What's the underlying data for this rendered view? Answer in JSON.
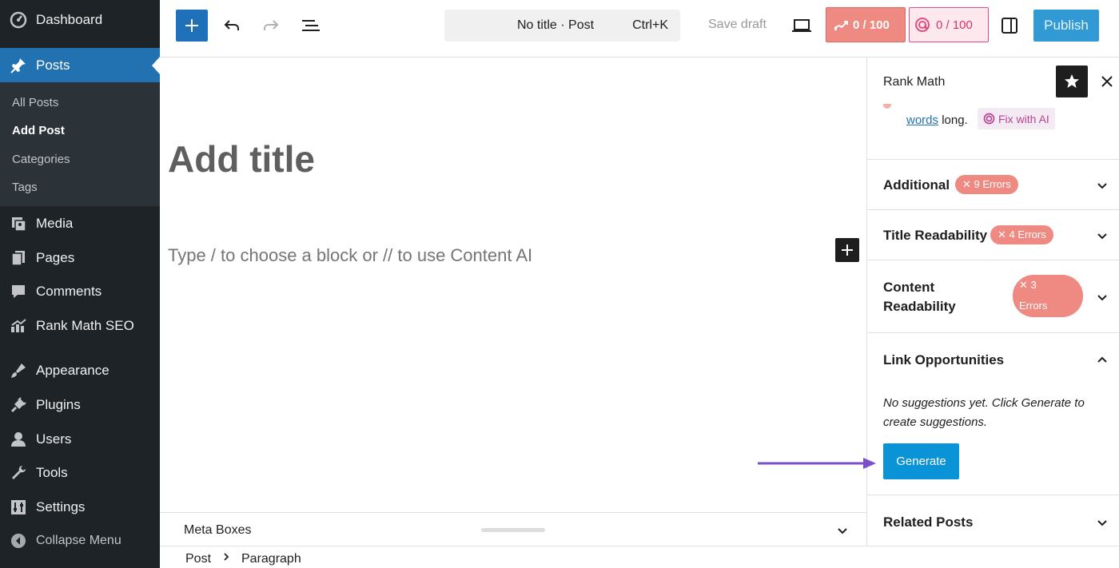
{
  "admin_menu": {
    "dashboard": "Dashboard",
    "posts": "Posts",
    "posts_sub": [
      "All Posts",
      "Add Post",
      "Categories",
      "Tags"
    ],
    "media": "Media",
    "pages": "Pages",
    "comments": "Comments",
    "rank_math": "Rank Math SEO",
    "appearance": "Appearance",
    "plugins": "Plugins",
    "users": "Users",
    "tools": "Tools",
    "settings": "Settings",
    "collapse": "Collapse Menu"
  },
  "toolbar": {
    "command_title": "No title · Post",
    "command_shortcut": "Ctrl+K",
    "save_draft": "Save draft",
    "seo_score": "0 / 100",
    "ai_score": "0 / 100",
    "publish": "Publish"
  },
  "editor": {
    "title_placeholder": "Add title",
    "block_placeholder": "Type / to choose a block or // to use Content AI"
  },
  "meta_boxes": {
    "label": "Meta Boxes"
  },
  "breadcrumbs": [
    "Post",
    "Paragraph"
  ],
  "sidebar": {
    "title": "Rank Math",
    "partial_link": "words",
    "partial_text": "long.",
    "fix_with_ai": "Fix with AI",
    "panels": {
      "additional": {
        "title": "Additional",
        "badge": "9 Errors"
      },
      "title_readability": {
        "title": "Title Readability",
        "badge": "4 Errors"
      },
      "content_readability": {
        "title_line1": "Content",
        "title_line2": "Readability",
        "badge_line1": "3",
        "badge_line2": "Errors"
      },
      "link_opportunities": {
        "title": "Link Opportunities",
        "message": "No suggestions yet. Click Generate to create suggestions.",
        "button": "Generate"
      },
      "related_posts": {
        "title": "Related Posts"
      }
    }
  },
  "colors": {
    "admin_bg": "#1d2327",
    "admin_active": "#2271b1",
    "publish": "#3199d4",
    "seo_score_bg": "#ef8a82",
    "badge_error": "#ef8a82",
    "generate": "#0a93d6",
    "arrow": "#7b4fc6"
  },
  "icons": {
    "admin": [
      "dashboard-icon",
      "pin-icon",
      "media-icon",
      "pages-icon",
      "comments-icon",
      "rank-math-icon",
      "appearance-icon",
      "plugins-icon",
      "users-icon",
      "tools-icon",
      "settings-icon",
      "collapse-icon"
    ],
    "toolbar": [
      "plus-icon",
      "undo-icon",
      "redo-icon",
      "list-view-icon",
      "desktop-preview-icon",
      "settings-sidebar-icon"
    ],
    "sidebar": [
      "star-icon",
      "close-icon",
      "chevron-down-icon",
      "chevron-up-icon"
    ]
  }
}
